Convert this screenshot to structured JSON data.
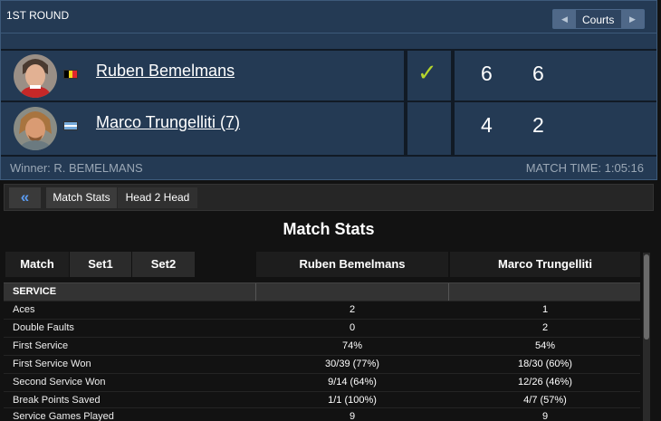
{
  "header": {
    "round": "1ST ROUND",
    "courts_label": "Courts",
    "prev_icon": "triangle-left",
    "next_icon": "triangle-right"
  },
  "players": [
    {
      "name": "Ruben Bemelmans",
      "flag": "belgium",
      "winner": true,
      "check": "✓",
      "sets": [
        "6",
        "6"
      ]
    },
    {
      "name": "Marco Trungelliti (7)",
      "flag": "argentina",
      "winner": false,
      "sets": [
        "4",
        "2"
      ]
    }
  ],
  "footer": {
    "winner": "Winner: R. BEMELMANS",
    "match_time": "MATCH TIME: 1:05:16"
  },
  "nav": {
    "back_icon": "«",
    "tabs": [
      "Match Stats",
      "Head 2 Head"
    ]
  },
  "stats": {
    "title": "Match Stats",
    "set_tabs": [
      "Match",
      "Set1",
      "Set2"
    ],
    "player1": "Ruben Bemelmans",
    "player2": "Marco Trungelliti",
    "section": "SERVICE",
    "rows": [
      {
        "label": "Aces",
        "p1": "2",
        "p2": "1"
      },
      {
        "label": "Double Faults",
        "p1": "0",
        "p2": "2"
      },
      {
        "label": "First Service",
        "p1": "74%",
        "p2": "54%"
      },
      {
        "label": "First Service Won",
        "p1": "30/39 (77%)",
        "p2": "18/30 (60%)"
      },
      {
        "label": "Second Service Won",
        "p1": "9/14 (64%)",
        "p2": "12/26 (46%)"
      },
      {
        "label": "Break Points Saved",
        "p1": "1/1 (100%)",
        "p2": "4/7 (57%)"
      },
      {
        "label": "Service Games Played",
        "p1": "9",
        "p2": "9"
      }
    ]
  },
  "colors": {
    "panel_bg": "#243a54",
    "check": "#b5d52c",
    "back_arrow": "#5b9cf2"
  }
}
